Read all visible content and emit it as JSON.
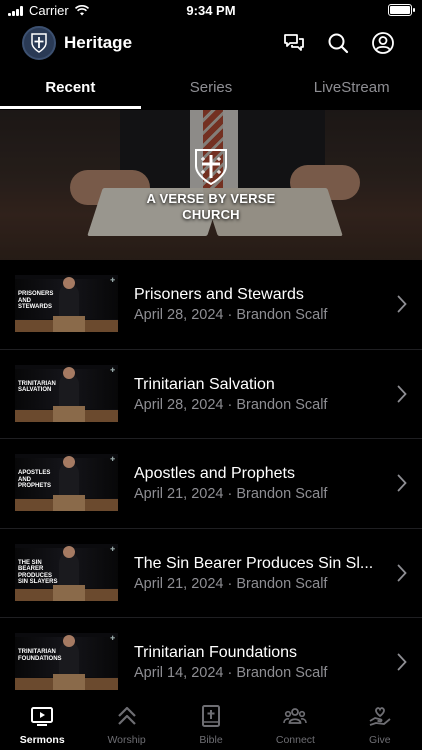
{
  "status_bar": {
    "carrier": "Carrier",
    "time": "9:34 PM"
  },
  "header": {
    "title": "Heritage"
  },
  "tabs": [
    {
      "label": "Recent",
      "active": true
    },
    {
      "label": "Series",
      "active": false
    },
    {
      "label": "LiveStream",
      "active": false
    }
  ],
  "hero": {
    "title_line1": "A VERSE BY VERSE",
    "title_line2": "CHURCH"
  },
  "sermons": [
    {
      "title": "Prisoners and Stewards",
      "subtitle": "April 28, 2024 · Brandon Scalf",
      "thumb_text": "Prisoners and Stewards"
    },
    {
      "title": "Trinitarian Salvation",
      "subtitle": "April 28, 2024 · Brandon Scalf",
      "thumb_text": "Trinitarian Salvation"
    },
    {
      "title": "Apostles and Prophets",
      "subtitle": "April 21, 2024 · Brandon Scalf",
      "thumb_text": "Apostles and Prophets"
    },
    {
      "title": "The Sin Bearer Produces Sin Sl...",
      "subtitle": "April 21, 2024 · Brandon Scalf",
      "thumb_text": "The Sin Bearer Produces Sin Slayers"
    },
    {
      "title": "Trinitarian Foundations",
      "subtitle": "April 14, 2024 · Brandon Scalf",
      "thumb_text": "Trinitarian Foundations"
    }
  ],
  "bottom_nav": [
    {
      "label": "Sermons",
      "icon": "play-screen-icon",
      "active": true
    },
    {
      "label": "Worship",
      "icon": "chevrons-up-icon",
      "active": false
    },
    {
      "label": "Bible",
      "icon": "bible-icon",
      "active": false
    },
    {
      "label": "Connect",
      "icon": "people-icon",
      "active": false
    },
    {
      "label": "Give",
      "icon": "hand-heart-icon",
      "active": false
    }
  ]
}
